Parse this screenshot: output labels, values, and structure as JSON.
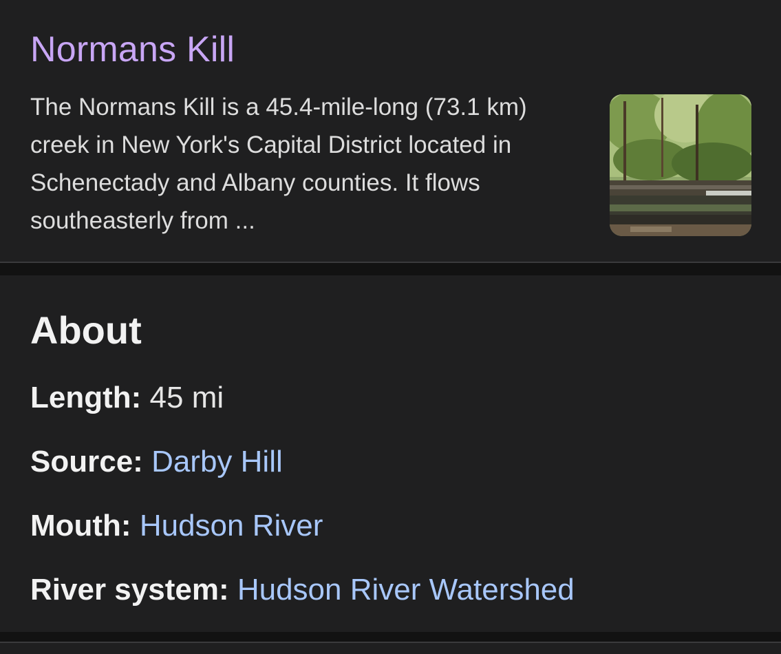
{
  "result": {
    "title": "Normans Kill",
    "snippet": "The Normans Kill is a 45.4-mile-long (73.1 km) creek in New York's Capital District located in Schenectady and Albany counties. It flows southeasterly from ..."
  },
  "about": {
    "heading": "About",
    "facts": [
      {
        "label": "Length:",
        "value": "45 mi"
      },
      {
        "label": "Source:",
        "value": "Darby Hill"
      },
      {
        "label": "Mouth:",
        "value": "Hudson River"
      },
      {
        "label": "River system:",
        "value": "Hudson River Watershed"
      }
    ]
  },
  "colors": {
    "background": "#171717",
    "card": "#1f1f20",
    "title_link": "#c8a6f5",
    "value_link": "#a8c7fa",
    "text": "#dddddd"
  }
}
